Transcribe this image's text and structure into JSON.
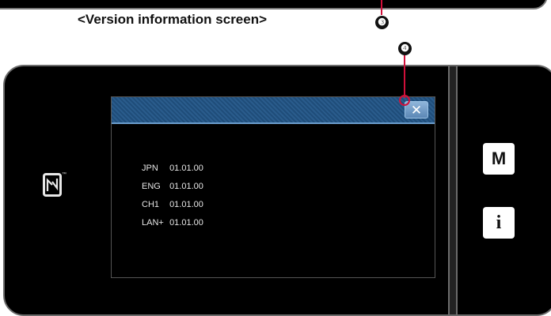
{
  "caption": "<Version information screen>",
  "callouts": {
    "three": "❸",
    "four": "❹"
  },
  "icons": {
    "nfc": "nfc-icon",
    "close": "close-icon"
  },
  "nfc_trademark": "™",
  "side_buttons": {
    "menu": "M",
    "info": "i"
  },
  "screen": {
    "close_label": "✕",
    "versions": [
      {
        "label": "JPN",
        "value": "01.01.00"
      },
      {
        "label": "ENG",
        "value": "01.01.00"
      },
      {
        "label": "CH1",
        "value": "01.01.00"
      },
      {
        "label": "LAN+",
        "value": "01.01.00"
      }
    ]
  },
  "colors": {
    "title_bar": "#1f4d7a",
    "accent_line": "#d0103a",
    "device": "#000000"
  }
}
